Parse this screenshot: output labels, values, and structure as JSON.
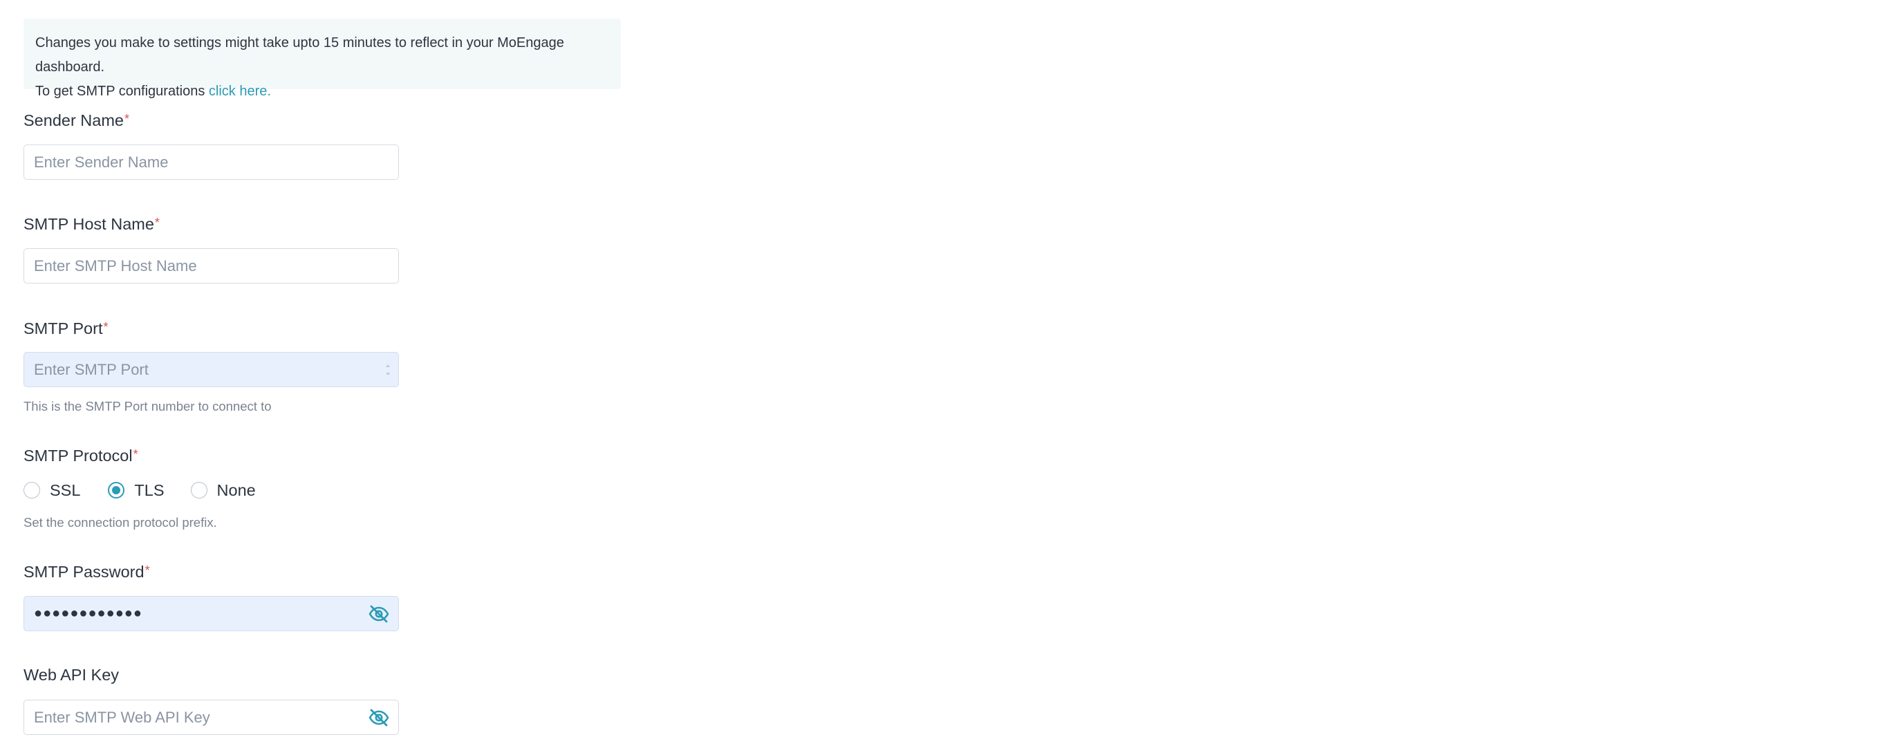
{
  "info": {
    "line1": "Changes you make to settings might take upto 15 minutes to reflect in your MoEngage dashboard.",
    "line2_prefix": "To get SMTP configurations",
    "line2_link": "click here."
  },
  "form": {
    "sender_name": {
      "label": "Sender Name",
      "placeholder": "Enter Sender Name",
      "value": ""
    },
    "smtp_host": {
      "label": "SMTP Host Name",
      "placeholder": "Enter SMTP Host Name",
      "value": ""
    },
    "smtp_port": {
      "label": "SMTP Port",
      "placeholder": "Enter SMTP Port",
      "value": "",
      "hint": "This is the SMTP Port number to connect to"
    },
    "smtp_protocol": {
      "label": "SMTP Protocol",
      "options": [
        "SSL",
        "TLS",
        "None"
      ],
      "selected": "TLS",
      "hint": "Set the connection protocol prefix."
    },
    "smtp_password": {
      "label": "SMTP Password",
      "value": "●●●●●●●●●●●●",
      "icon": "eye-off-icon"
    },
    "web_api_key": {
      "label": "Web API Key",
      "placeholder": "Enter SMTP Web API Key",
      "value": "",
      "icon": "eye-off-icon"
    },
    "required_marker": "*"
  },
  "colors": {
    "accent": "#2b9bb5",
    "required": "#d9534f",
    "info_bg": "#f3f9f9",
    "filled_input_bg": "#e9f0fd"
  }
}
